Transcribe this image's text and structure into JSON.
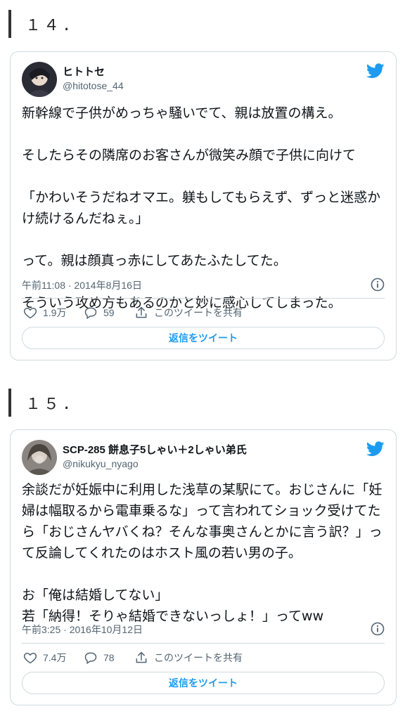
{
  "sections": [
    {
      "number": "１４.",
      "tweet": {
        "display_name": "ヒトトセ",
        "handle": "@hitotose_44",
        "body": "新幹線で子供がめっちゃ騒いでて、親は放置の構え。\n\nそしたらその隣席のお客さんが微笑み顔で子供に向けて\n\n「かわいそうだねオマエ。躾もしてもらえず、ずっと迷惑かけ続けるんだねぇ。」\n\nって。親は顔真っ赤にしてあたふたしてた。\n\nそういう攻め方もあるのかと妙に感心してしまった。",
        "timestamp": "午前11:08 · 2014年8月16日",
        "likes": "1.9万",
        "replies": "59",
        "share_label": "このツイートを共有",
        "reply_button": "返信をツイート"
      }
    },
    {
      "number": "１５.",
      "tweet": {
        "display_name": "SCP-285 餅息子5しゃい＋2しゃい弟氏",
        "handle": "@nikukyu_nyago",
        "body": "余談だが妊娠中に利用した浅草の某駅にて。おじさんに「妊婦は幅取るから電車乗るな」って言われてショック受けてたら「おじさんヤバくね？そんな事奥さんとかに言う訳？」って反論してくれたのはホスト風の若い男の子。\n\nお「俺は結婚してない」\n若「納得！そりゃ結婚できないっしょ！」ってww",
        "timestamp": "午前3:25 · 2016年10月12日",
        "likes": "7.4万",
        "replies": "78",
        "share_label": "このツイートを共有",
        "reply_button": "返信をツイート"
      }
    }
  ],
  "colors": {
    "accent": "#1d9bf0",
    "text": "#0f1419",
    "muted": "#536471",
    "border": "#cfd9de"
  },
  "icons": [
    "twitter-bird-icon",
    "info-icon",
    "heart-icon",
    "reply-bubble-icon",
    "share-icon"
  ]
}
